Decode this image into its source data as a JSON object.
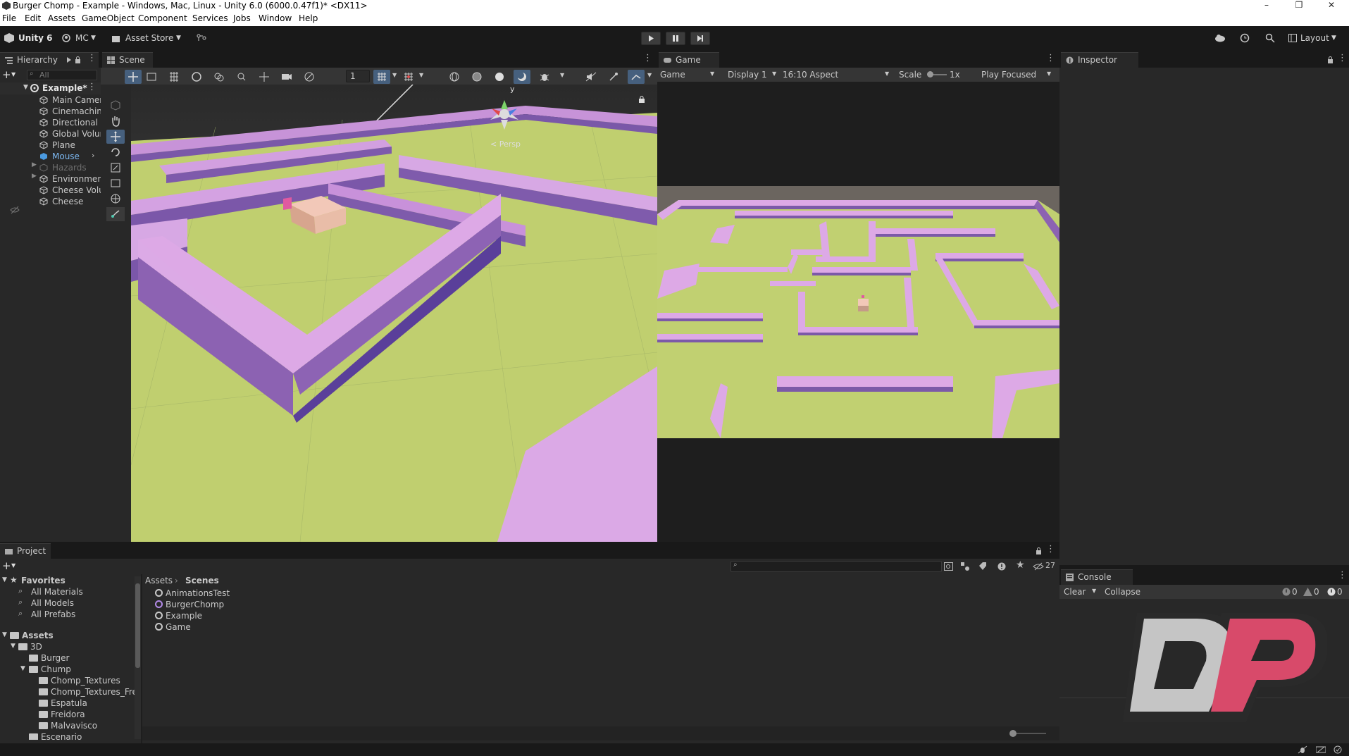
{
  "window": {
    "title": "Burger Chomp - Example - Windows, Mac, Linux - Unity 6.0 (6000.0.47f1)* <DX11>",
    "controls": [
      "–",
      "❐",
      "✕"
    ]
  },
  "menu": [
    "File",
    "Edit",
    "Assets",
    "GameObject",
    "Component",
    "Services",
    "Jobs",
    "Window",
    "Help"
  ],
  "toolbar": {
    "unity_label": "Unity 6",
    "account": "MC",
    "asset_store": "Asset Store",
    "layout": "Layout"
  },
  "hierarchy": {
    "tab": "Hierarchy",
    "search_placeholder": "All",
    "scene": "Example*",
    "items": [
      "Main Camera",
      "Cinemachine",
      "Directional Light",
      "Global Volume",
      "Plane",
      "Mouse",
      "Hazards",
      "Environment",
      "Cheese Volume",
      "Cheese"
    ]
  },
  "scene": {
    "tab": "Scene",
    "grid_value": "1",
    "persp": "< Persp",
    "gizmo_y": "y"
  },
  "game": {
    "tab": "Game",
    "mode": "Game",
    "display": "Display 1",
    "aspect": "16:10 Aspect",
    "scale_label": "Scale",
    "scale_value": "1x",
    "play_mode": "Play Focused"
  },
  "inspector": {
    "tab": "Inspector"
  },
  "project": {
    "tab": "Project",
    "hidden_count": "27",
    "favorites_label": "Favorites",
    "favorites": [
      "All Materials",
      "All Models",
      "All Prefabs"
    ],
    "assets_label": "Assets",
    "tree": [
      {
        "label": "3D",
        "level": 1
      },
      {
        "label": "Burger",
        "level": 2
      },
      {
        "label": "Chump",
        "level": 2
      },
      {
        "label": "Chomp_Textures",
        "level": 3
      },
      {
        "label": "Chomp_Textures_Fre",
        "level": 3
      },
      {
        "label": "Espatula",
        "level": 3
      },
      {
        "label": "Freidora",
        "level": 3
      },
      {
        "label": "Malvavisco",
        "level": 3
      },
      {
        "label": "Escenario",
        "level": 2
      }
    ],
    "breadcrumb": [
      "Assets",
      "Scenes"
    ],
    "files": [
      "AnimationsTest",
      "BurgerChomp",
      "Example",
      "Game"
    ]
  },
  "console": {
    "tab": "Console",
    "clear": "Clear",
    "collapse": "Collapse",
    "log_count": "0",
    "warn_count": "0",
    "error_count": "0"
  },
  "colors": {
    "wall_top": "#dca6e2",
    "wall_side": "#8d63b4",
    "floor": "#c0d070",
    "accent": "#4a8ad8"
  },
  "watermark_letters": "DP"
}
